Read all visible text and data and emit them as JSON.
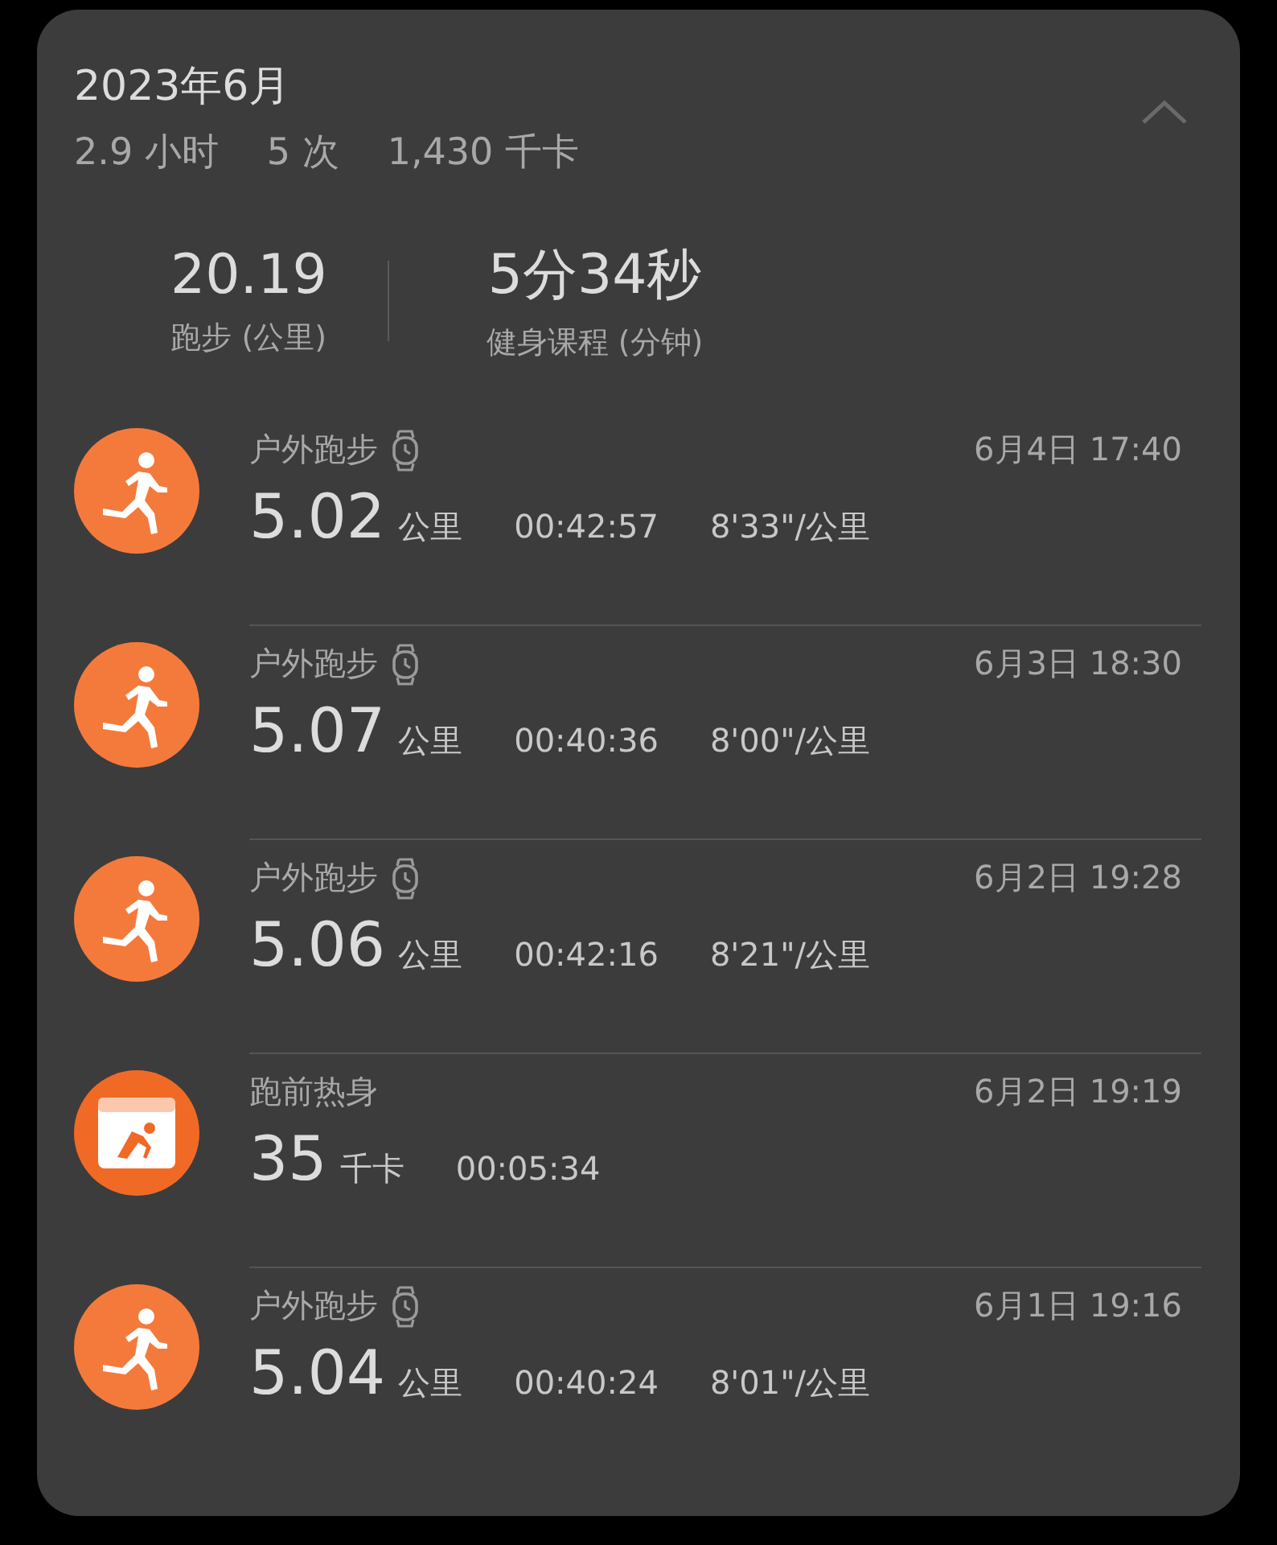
{
  "month": {
    "title": "2023年6月",
    "expanded": true,
    "summary": [
      "2.9 小时",
      "5 次",
      "1,430 千卡"
    ]
  },
  "totals": [
    {
      "value": "20.19",
      "label": "跑步 (公里)"
    },
    {
      "value": "5分34秒",
      "label": "健身课程 (分钟)"
    }
  ],
  "activities": [
    {
      "kind": "run",
      "title": "户外跑步",
      "watch": true,
      "value": "5.02",
      "unit": "公里",
      "duration": "00:42:57",
      "pace": "8'33\"/公里",
      "date": "6月4日 17:40"
    },
    {
      "kind": "run",
      "title": "户外跑步",
      "watch": true,
      "value": "5.07",
      "unit": "公里",
      "duration": "00:40:36",
      "pace": "8'00\"/公里",
      "date": "6月3日 18:30"
    },
    {
      "kind": "run",
      "title": "户外跑步",
      "watch": true,
      "value": "5.06",
      "unit": "公里",
      "duration": "00:42:16",
      "pace": "8'21\"/公里",
      "date": "6月2日 19:28"
    },
    {
      "kind": "workout",
      "title": "跑前热身",
      "watch": false,
      "value": "35",
      "unit": "千卡",
      "duration": "00:05:34",
      "date": "6月2日 19:19"
    },
    {
      "kind": "run",
      "title": "户外跑步",
      "watch": true,
      "value": "5.04",
      "unit": "公里",
      "duration": "00:40:24",
      "pace": "8'01\"/公里",
      "date": "6月1日 19:16"
    }
  ]
}
